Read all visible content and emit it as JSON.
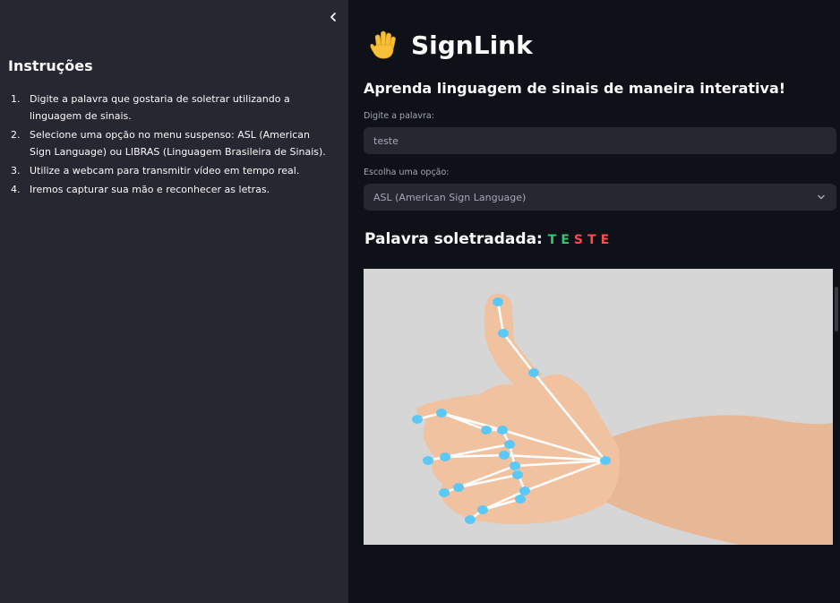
{
  "sidebar": {
    "collapse_icon": "chevron-left-icon",
    "title": "Instruções",
    "instructions": [
      {
        "num": "1.",
        "text": "Digite a palavra que gostaria de soletrar utilizando a linguagem de sinais."
      },
      {
        "num": "2.",
        "text": "Selecione uma opção no menu suspenso: ASL (American Sign Language) ou LIBRAS (Linguagem Brasileira de Sinais)."
      },
      {
        "num": "3.",
        "text": "Utilize a webcam para transmitir vídeo em tempo real."
      },
      {
        "num": "4.",
        "text": "Iremos capturar sua mão e reconhecer as letras."
      }
    ]
  },
  "main": {
    "app_icon": "raised-hand-icon",
    "app_title": "SignLink",
    "subtitle": "Aprenda linguagem de sinais de maneira interativa!",
    "word_label": "Digite a palavra:",
    "word_value": "teste",
    "option_label": "Escolha uma opção:",
    "option_selected": "ASL (American Sign Language)",
    "spelled_label": "Palavra soletradada:",
    "spelled_letters": [
      {
        "char": "T",
        "color": "#2ecc71"
      },
      {
        "char": "E",
        "color": "#2ecc71"
      },
      {
        "char": "S",
        "color": "#ff4b4b"
      },
      {
        "char": "T",
        "color": "#ff4b4b"
      },
      {
        "char": "E",
        "color": "#ff4b4b"
      }
    ]
  },
  "colors": {
    "sidebar_bg": "#262730",
    "main_bg": "#0e1117",
    "input_bg": "#262730",
    "landmark": "#5bc8f5",
    "connection": "#ffffff"
  }
}
